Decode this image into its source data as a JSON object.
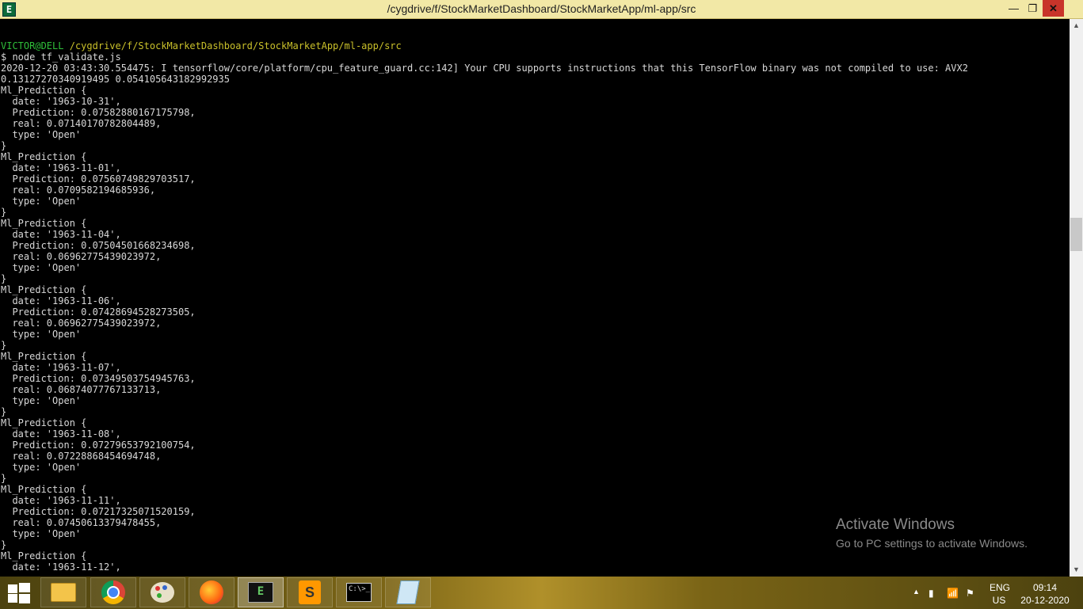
{
  "window": {
    "title": "/cygdrive/f/StockMarketDashboard/StockMarketApp/ml-app/src",
    "app_icon_letter": "E",
    "controls": {
      "minimize": "—",
      "maximize": "❐",
      "close": "✕"
    }
  },
  "terminal": {
    "prompt_user": "VICTOR@DELL",
    "prompt_path": "/cygdrive/f/StockMarketDashboard/StockMarketApp/ml-app/src",
    "command": "$ node tf_validate.js",
    "log_line": "2020-12-20 03:43:30.554475: I tensorflow/core/platform/cpu_feature_guard.cc:142] Your CPU supports instructions that this TensorFlow binary was not compiled to use: AVX2",
    "stats_line": "0.13127270340919495 0.054105643182992935",
    "record_label": "Ml_Prediction",
    "records": [
      {
        "date": "1963-10-31",
        "prediction": "0.07582880167175798",
        "real": "0.07140170782804489",
        "type": "Open"
      },
      {
        "date": "1963-11-01",
        "prediction": "0.07560749829703517",
        "real": "0.0709582194685936",
        "type": "Open"
      },
      {
        "date": "1963-11-04",
        "prediction": "0.07504501668234698",
        "real": "0.06962775439023972",
        "type": "Open"
      },
      {
        "date": "1963-11-06",
        "prediction": "0.07428694528273505",
        "real": "0.06962775439023972",
        "type": "Open"
      },
      {
        "date": "1963-11-07",
        "prediction": "0.07349503754945763",
        "real": "0.06874077767133713",
        "type": "Open"
      },
      {
        "date": "1963-11-08",
        "prediction": "0.07279653792100754",
        "real": "0.07228868454694748",
        "type": "Open"
      },
      {
        "date": "1963-11-11",
        "prediction": "0.07217325071520159",
        "real": "0.07450613379478455",
        "type": "Open"
      }
    ],
    "last_partial": {
      "date": "1963-11-12"
    }
  },
  "watermark": {
    "title": "Activate Windows",
    "subtitle": "Go to PC settings to activate Windows."
  },
  "taskbar": {
    "apps": [
      {
        "name": "file-explorer",
        "active": false
      },
      {
        "name": "chrome",
        "active": false
      },
      {
        "name": "paint",
        "active": false
      },
      {
        "name": "firefox",
        "active": false
      },
      {
        "name": "cygwin-terminal",
        "active": true
      },
      {
        "name": "sublime-text",
        "active": false
      },
      {
        "name": "command-prompt",
        "active": false
      },
      {
        "name": "notepad",
        "active": false
      }
    ],
    "language": "ENG",
    "region": "US",
    "time": "09:14",
    "date": "20-12-2020"
  },
  "colors": {
    "prompt_user": "#2fbf3a",
    "prompt_path": "#c9c02a",
    "title_bar": "#f2e8a6",
    "close_button": "#c8342a"
  }
}
